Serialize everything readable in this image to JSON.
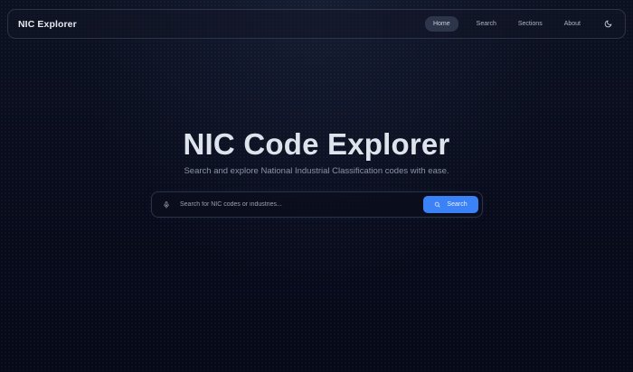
{
  "nav": {
    "brand": "NIC Explorer",
    "links": [
      "Home",
      "Search",
      "Sections",
      "About"
    ],
    "active": "Home",
    "theme_icon": "moon-icon"
  },
  "hero": {
    "title": "NIC Code Explorer",
    "subtitle": "Search and explore National Industrial Classification codes with ease."
  },
  "search": {
    "placeholder": "Search for NIC codes or industries...",
    "value": "",
    "button_label": "Search",
    "mic_icon": "microphone-icon",
    "button_icon": "search-icon"
  },
  "colors": {
    "background": "#070b19",
    "accent": "#3b82f6"
  }
}
